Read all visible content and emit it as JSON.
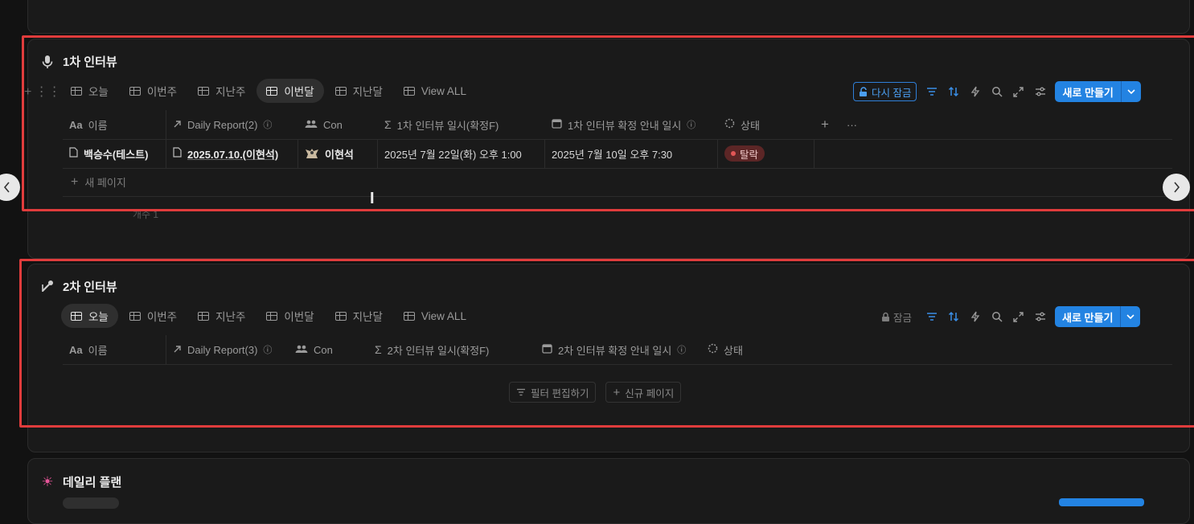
{
  "section1": {
    "title": "1차 인터뷰",
    "tabs": [
      {
        "label": "오늘"
      },
      {
        "label": "이번주"
      },
      {
        "label": "지난주"
      },
      {
        "label": "이번달"
      },
      {
        "label": "지난달"
      },
      {
        "label": "View ALL"
      }
    ],
    "active_tab": "이번달",
    "lock_label": "다시 잠금",
    "new_button": "새로 만들기",
    "columns": [
      "이름",
      "Daily Report(2)",
      "Con",
      "1차 인터뷰 일시(확정F)",
      "1차 인터뷰 확정 안내 일시",
      "상태"
    ],
    "column_icons": [
      "Aa",
      "arrow-up-right-icon",
      "people-icon",
      "sigma-icon",
      "calendar-icon",
      "status-icon"
    ],
    "row": {
      "name": "백승수(테스트)",
      "daily_report": "2025.07.10.(이현석)",
      "con": "이현석",
      "interview_time": "2025년 7월 22일(화) 오후 1:00",
      "notice_time": "2025년 7월 10일 오후 7:30",
      "status": "탈락"
    },
    "new_page": "새 페이지",
    "count_label": "개수 1",
    "aa": "Aa",
    "plus": "+",
    "more": "···"
  },
  "section2": {
    "title": "2차 인터뷰",
    "tabs": [
      {
        "label": "오늘"
      },
      {
        "label": "이번주"
      },
      {
        "label": "지난주"
      },
      {
        "label": "이번달"
      },
      {
        "label": "지난달"
      },
      {
        "label": "View ALL"
      }
    ],
    "active_tab": "오늘",
    "lock_label": "잠금",
    "new_button": "새로 만들기",
    "columns": [
      "이름",
      "Daily Report(3)",
      "Con",
      "2차 인터뷰 일시(확정F)",
      "2차 인터뷰 확정 안내 일시",
      "상태"
    ],
    "filter_button": "필터 편집하기",
    "new_page_button": "신규 페이지",
    "aa": "Aa"
  },
  "section3": {
    "title": "데일리 플랜"
  },
  "colors": {
    "background": "#121212",
    "card": "#1a1a1a",
    "accent": "#2383e2",
    "highlight": "#e03c3c",
    "status_red": "#5c2626"
  }
}
